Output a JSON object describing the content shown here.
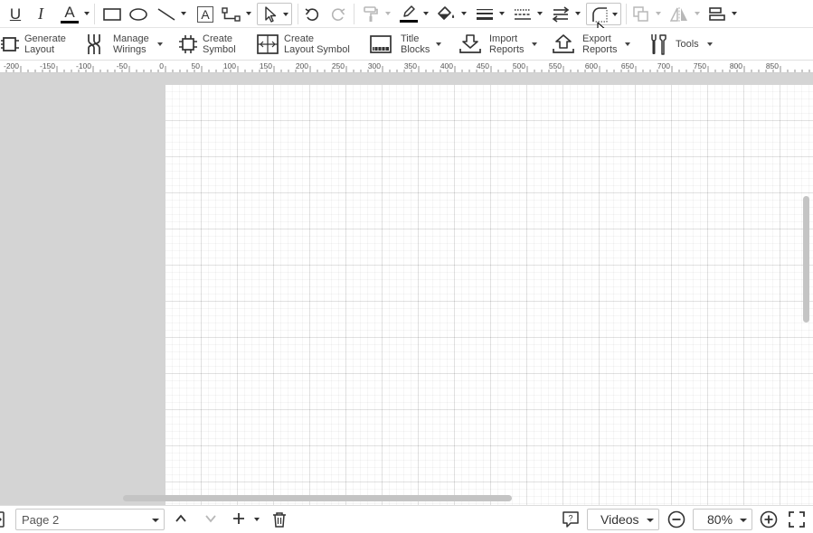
{
  "format_toolbar": {
    "underline_glyph": "U",
    "italic_glyph": "I",
    "font_color_glyph": "A",
    "text_tool_glyph": "A",
    "icons": [
      "underline-icon",
      "italic-icon",
      "font-color-icon",
      "rectangle-icon",
      "ellipse-icon",
      "line-icon",
      "text-tool-icon",
      "connector-icon",
      "pointer-icon",
      "undo-icon",
      "redo-icon",
      "format-painter-icon",
      "line-color-icon",
      "fill-color-icon",
      "line-weight-icon",
      "line-dash-icon",
      "line-ends-icon",
      "corner-rounding-icon",
      "arrange-icon",
      "flip-icon",
      "align-icon"
    ],
    "accent_colors": {
      "font_color_bar": "#000000",
      "line_color_bar": "#000000"
    }
  },
  "electrical_toolbar": {
    "items": [
      {
        "label": "Generate\nLayout",
        "icon": "generate-layout-icon",
        "has_menu": false
      },
      {
        "label": "Manage\nWirings",
        "icon": "manage-wirings-icon",
        "has_menu": true
      },
      {
        "label": "Create\nSymbol",
        "icon": "create-symbol-icon",
        "has_menu": false
      },
      {
        "label": "Create\nLayout Symbol",
        "icon": "create-layout-symbol-icon",
        "has_menu": false
      },
      {
        "label": "Title\nBlocks",
        "icon": "title-blocks-icon",
        "has_menu": true
      },
      {
        "label": "Import\nReports",
        "icon": "import-reports-icon",
        "has_menu": true
      },
      {
        "label": "Export\nReports",
        "icon": "export-reports-icon",
        "has_menu": true
      },
      {
        "label": "Tools",
        "icon": "tools-icon",
        "has_menu": true
      }
    ]
  },
  "ruler": {
    "labels": [
      "-200",
      "-150",
      "-100",
      "-50",
      "0",
      "50",
      "100",
      "150",
      "200",
      "250",
      "300",
      "350",
      "400",
      "450",
      "500",
      "550",
      "600",
      "650",
      "700",
      "750",
      "800",
      "850"
    ]
  },
  "bottom_bar": {
    "page_select_value": "Page 2",
    "videos_label": "Videos",
    "zoom_value": "80%"
  },
  "colors": {
    "canvas_background": "#d4d4d4",
    "page_background": "#ffffff",
    "scrollbar": "#c4c4c4"
  }
}
